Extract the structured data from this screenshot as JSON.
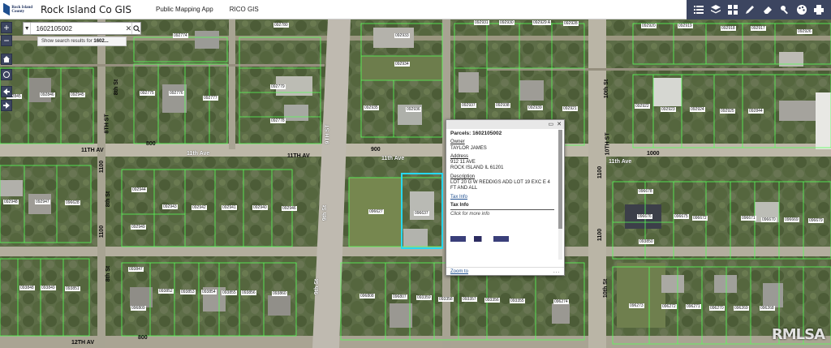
{
  "header": {
    "logo_text": "Rock Island County",
    "app_title": "Rock Island Co GIS",
    "nav": [
      "Public Mapping App",
      "RICO GIS"
    ]
  },
  "toolbar": {
    "icons": [
      "list-icon",
      "layers-icon",
      "basemap-grid-icon",
      "draw-pencil-icon",
      "eraser-icon",
      "tools-icon",
      "palette-icon",
      "print-icon"
    ]
  },
  "search": {
    "value": "1602105002",
    "dropdown_icon": "caret-down-icon",
    "suggest_prefix": "Show search results for",
    "suggest_query": "1602..."
  },
  "controls": [
    "zoom-in",
    "zoom-out",
    "home",
    "locate",
    "back",
    "forward"
  ],
  "popup": {
    "title": "Parcels: 1602105002",
    "owner_label": "Owner",
    "owner_value": "TAYLOR JAMES",
    "address_label": "Address",
    "address_line1": "912 11 AVE",
    "address_line2": "ROCK ISLAND IL 61201",
    "description_label": "Description",
    "description_value": "LOT 20 G W REDDIGS ADD LOT 19 EXC E 4 FT AND ALL",
    "tax_info_link": "Tax Info",
    "tax_info_heading": "Tax Info",
    "tax_click": "Click for more info",
    "zoom_to": "Zoom to",
    "more": "..."
  },
  "streets": {
    "h1": "11TH AV",
    "h2": "11th Ave",
    "h3": "11th Ave",
    "h4": "11TH AV",
    "h5": "12TH AV",
    "h_right": "11th Ave",
    "num_800_top": "800",
    "num_900_top": "900",
    "num_1000_top": "1000",
    "num_800_bottom": "800",
    "num_1100_a": "1100",
    "num_1100_b": "1100",
    "num_1100_c": "1100",
    "num_1100_d": "1100",
    "v_8th_a": "8th St",
    "v_8th_b": "8TH ST",
    "v_8th_c": "8th St",
    "v_9th": "9th St",
    "v_9th_b": "9TH ST",
    "v_9th_c": "9th St",
    "v_10th_a": "10TH ST",
    "v_10th_b": "10th St",
    "v_10th_c": "10th St"
  },
  "parcels": [
    {
      "id": "092774"
    },
    {
      "id": "092780"
    },
    {
      "id": "092933"
    },
    {
      "id": "092934"
    },
    {
      "id": "092931"
    },
    {
      "id": "092930"
    },
    {
      "id": "092929 A"
    },
    {
      "id": "092928"
    },
    {
      "id": "092920"
    },
    {
      "id": "092919"
    },
    {
      "id": "092918"
    },
    {
      "id": "092917"
    },
    {
      "id": "092926"
    },
    {
      "id": "092779"
    },
    {
      "id": "092778"
    },
    {
      "id": "092776"
    },
    {
      "id": "092775"
    },
    {
      "id": "092777"
    },
    {
      "id": "092935"
    },
    {
      "id": "092936"
    },
    {
      "id": "092937"
    },
    {
      "id": "092938"
    },
    {
      "id": "092939"
    },
    {
      "id": "092921"
    },
    {
      "id": "092922"
    },
    {
      "id": "092923"
    },
    {
      "id": "092924"
    },
    {
      "id": "092925"
    },
    {
      "id": "092844"
    },
    {
      "id": "092845"
    },
    {
      "id": "092846"
    },
    {
      "id": "092945"
    },
    {
      "id": "092944"
    },
    {
      "id": "092943"
    },
    {
      "id": "092942"
    },
    {
      "id": "092941"
    },
    {
      "id": "092940"
    },
    {
      "id": "092946"
    },
    {
      "id": "092949"
    },
    {
      "id": "092948"
    },
    {
      "id": "092947"
    },
    {
      "id": "096628"
    },
    {
      "id": "096627"
    },
    {
      "id": "096637"
    },
    {
      "id": "096678"
    },
    {
      "id": "096676"
    },
    {
      "id": "096675"
    },
    {
      "id": "096672"
    },
    {
      "id": "096671"
    },
    {
      "id": "096670"
    },
    {
      "id": "096669"
    },
    {
      "id": "096679"
    },
    {
      "id": "093850"
    },
    {
      "id": "093847"
    },
    {
      "id": "093848"
    },
    {
      "id": "093849"
    },
    {
      "id": "093851"
    },
    {
      "id": "093852"
    },
    {
      "id": "093853"
    },
    {
      "id": "093854"
    },
    {
      "id": "093855"
    },
    {
      "id": "093856"
    },
    {
      "id": "093860"
    },
    {
      "id": "096809"
    },
    {
      "id": "096808"
    },
    {
      "id": "096807"
    },
    {
      "id": "093359"
    },
    {
      "id": "093358"
    },
    {
      "id": "093357"
    },
    {
      "id": "093356"
    },
    {
      "id": "093355"
    },
    {
      "id": "096274"
    },
    {
      "id": "096273"
    },
    {
      "id": "096272"
    },
    {
      "id": "096271"
    },
    {
      "id": "096270"
    },
    {
      "id": "096269"
    },
    {
      "id": "096268"
    }
  ],
  "watermark": "RMLSA"
}
